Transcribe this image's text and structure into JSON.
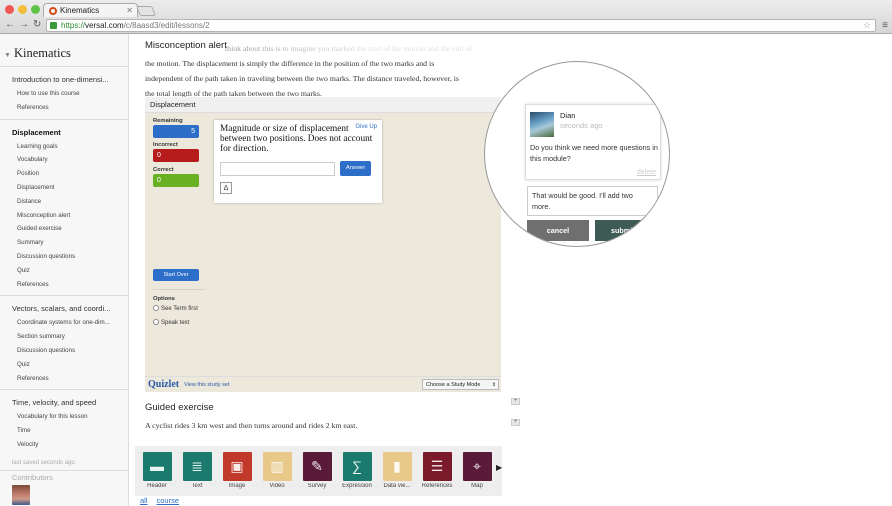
{
  "browser": {
    "tab_title": "Kinematics",
    "url_scheme": "https://",
    "url_host": "versal.com",
    "url_path": "/c/8aasd3/edit/lessons/2"
  },
  "sidebar": {
    "course_title": "Kinematics",
    "sections": [
      {
        "title": "Introduction to one-dimensi...",
        "items": [
          "How to use this course",
          "References"
        ]
      },
      {
        "title": "Displacement",
        "active": true,
        "items": [
          "Learning goals",
          "Vocabulary",
          "Position",
          "Displacement",
          "Distance",
          "Misconception alert",
          "Guided exercise",
          "Summary",
          "Discussion questions",
          "Quiz",
          "References"
        ]
      },
      {
        "title": "Vectors, scalars, and coordi...",
        "items": [
          "Coordinate systems for one-dim...",
          "Section summary",
          "Discussion questions",
          "Quiz",
          "References"
        ]
      },
      {
        "title": "Time, velocity, and speed",
        "items": [
          "Vocabulary for this lesson",
          "Time",
          "Velocity"
        ]
      }
    ],
    "saved_status": "last saved seconds ago",
    "contributors_label": "Contributors"
  },
  "main": {
    "misconception_heading": "Misconception alert",
    "para_line1": "think about this is to imagine you marked the start of the motion and the end of",
    "para_line2": "the motion. The displacement is simply the difference in the position of the two marks and is",
    "para_line3": "independent of the path taken in traveling between the two marks. The distance traveled, however, is",
    "para_line4": "the total length of the path taken between the two marks.",
    "guided_heading": "Guided exercise",
    "guided_text": "A cyclist rides 3 km west and then turns around and rides 2 km east."
  },
  "quizlet": {
    "header": "Displacement",
    "remaining_label": "Remaining",
    "remaining_value": "5",
    "incorrect_label": "Incorrect",
    "incorrect_value": "0",
    "correct_label": "Correct",
    "correct_value": "0",
    "start_over": "Start Over",
    "options_label": "Options",
    "option1": "See Term first",
    "option2": "Speak text",
    "question": "Magnitude or size of displacement between two positions. Does not account for direction.",
    "give_up": "Give Up",
    "answer_btn": "Answer",
    "delta_btn": "Δ",
    "brand": "Quizlet",
    "view_set": "View this study set",
    "study_mode": "Choose a Study Mode",
    "colors": {
      "remaining": "#2d6ec8",
      "incorrect": "#b71c1c",
      "correct": "#6ab023"
    }
  },
  "comment": {
    "marker": "1",
    "author": "Dian",
    "time": "seconds ago",
    "text": "Do you think we need more questions in this module?",
    "delete": "delete",
    "reply_text": "That would be good. I'll add two more.",
    "cancel": "cancel",
    "submit": "submit"
  },
  "palette": {
    "items": [
      {
        "label": "Header",
        "icon": "header-icon",
        "color": "#1a7a6e"
      },
      {
        "label": "Text",
        "icon": "text-icon",
        "color": "#1a7a6e"
      },
      {
        "label": "Image",
        "icon": "image-icon",
        "color": "#c0392b"
      },
      {
        "label": "Video",
        "icon": "video-icon",
        "color": "#e8c98a"
      },
      {
        "label": "Survey",
        "icon": "survey-icon",
        "color": "#5a1a3a"
      },
      {
        "label": "Expression",
        "icon": "expression-icon",
        "color": "#1a7a6e"
      },
      {
        "label": "Data vie...",
        "icon": "data-viz-icon",
        "color": "#e8c98a"
      },
      {
        "label": "References",
        "icon": "references-icon",
        "color": "#7a1a2a"
      },
      {
        "label": "Map",
        "icon": "map-icon",
        "color": "#5a1a3a"
      }
    ],
    "filter_all": "all",
    "filter_course": "course"
  }
}
